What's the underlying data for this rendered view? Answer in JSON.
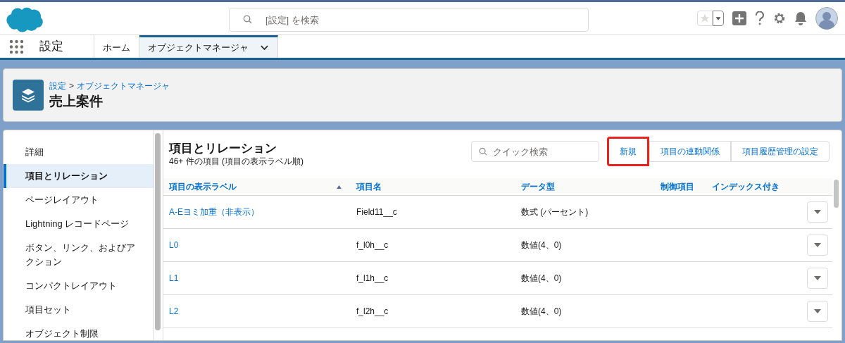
{
  "global_search": {
    "placeholder": "[設定] を検索"
  },
  "app_name": "設定",
  "nav_tabs": [
    {
      "label": "ホーム",
      "selected": false,
      "has_menu": false
    },
    {
      "label": "オブジェクトマネージャ",
      "selected": true,
      "has_menu": true
    }
  ],
  "header": {
    "breadcrumbs": [
      "設定",
      "オブジェクトマネージャ"
    ],
    "separator": ">",
    "title": "売上案件"
  },
  "sidebar": {
    "items": [
      {
        "label": "詳細",
        "selected": false
      },
      {
        "label": "項目とリレーション",
        "selected": true
      },
      {
        "label": "ページレイアウト",
        "selected": false
      },
      {
        "label": "Lightning レコードページ",
        "selected": false
      },
      {
        "label": "ボタン、リンク、およびアクション",
        "selected": false
      },
      {
        "label": "コンパクトレイアウト",
        "selected": false
      },
      {
        "label": "項目セット",
        "selected": false
      },
      {
        "label": "オブジェクト制限",
        "selected": false
      }
    ]
  },
  "section": {
    "title": "項目とリレーション",
    "subtitle": "46+ 件の項目 (項目の表示ラベル順)",
    "quick_search": {
      "placeholder": "クイック検索"
    },
    "buttons": [
      {
        "label": "新規",
        "highlighted": true
      },
      {
        "label": "項目の連動関係",
        "highlighted": false
      },
      {
        "label": "項目履歴管理の設定",
        "highlighted": false
      }
    ]
  },
  "table": {
    "columns": [
      {
        "label": "項目の表示ラベル",
        "sorted": true
      },
      {
        "label": "項目名",
        "sorted": false
      },
      {
        "label": "データ型",
        "sorted": false
      },
      {
        "label": "制御項目",
        "sorted": false
      },
      {
        "label": "インデックス付き",
        "sorted": false
      }
    ],
    "rows": [
      {
        "label": "A-Eヨミ加重（非表示）",
        "name": "Field11__c",
        "type": "数式 (パーセント)"
      },
      {
        "label": "L0",
        "name": "f_l0h__c",
        "type": "数値(4、0)"
      },
      {
        "label": "L1",
        "name": "f_l1h__c",
        "type": "数値(4、0)"
      },
      {
        "label": "L2",
        "name": "f_l2h__c",
        "type": "数値(4、0)"
      }
    ]
  }
}
